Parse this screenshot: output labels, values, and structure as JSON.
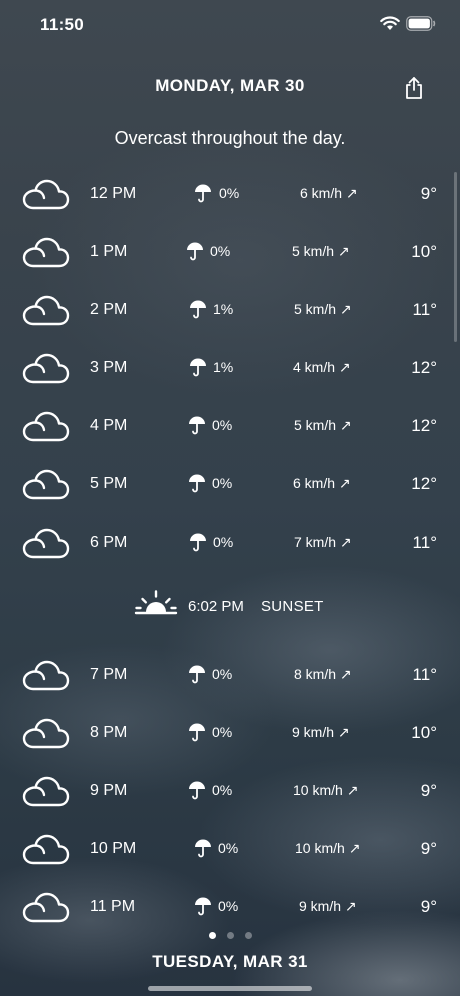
{
  "status": {
    "time": "11:50"
  },
  "header": {
    "title": "MONDAY, MAR 30"
  },
  "summary": "Overcast throughout the day.",
  "hours": [
    {
      "hour": "12 PM",
      "precip": "0%",
      "wind": "6 km/h ↗",
      "temp": "9°",
      "icon": "cloud-icon",
      "umbX": 194,
      "pctX": 219,
      "windX": 300
    },
    {
      "hour": "1 PM",
      "precip": "0%",
      "wind": "5 km/h ↗",
      "temp": "10°",
      "icon": "cloud-icon",
      "umbX": 186,
      "pctX": 210,
      "windX": 292
    },
    {
      "hour": "2 PM",
      "precip": "1%",
      "wind": "5 km/h ↗",
      "temp": "11°",
      "icon": "cloud-icon",
      "umbX": 189,
      "pctX": 213,
      "windX": 294
    },
    {
      "hour": "3 PM",
      "precip": "1%",
      "wind": "4 km/h ↗",
      "temp": "12°",
      "icon": "cloud-icon",
      "umbX": 189,
      "pctX": 213,
      "windX": 293
    },
    {
      "hour": "4 PM",
      "precip": "0%",
      "wind": "5 km/h ↗",
      "temp": "12°",
      "icon": "cloud-icon",
      "umbX": 188,
      "pctX": 212,
      "windX": 294
    },
    {
      "hour": "5 PM",
      "precip": "0%",
      "wind": "6 km/h ↗",
      "temp": "12°",
      "icon": "cloud-icon",
      "umbX": 188,
      "pctX": 212,
      "windX": 293
    },
    {
      "hour": "6 PM",
      "precip": "0%",
      "wind": "7 km/h ↗",
      "temp": "11°",
      "icon": "cloud-icon",
      "umbX": 189,
      "pctX": 213,
      "windX": 294
    },
    {
      "hour": "7 PM",
      "precip": "0%",
      "wind": "8 km/h ↗",
      "temp": "11°",
      "icon": "cloud-icon",
      "umbX": 188,
      "pctX": 212,
      "windX": 294
    },
    {
      "hour": "8 PM",
      "precip": "0%",
      "wind": "9 km/h ↗",
      "temp": "10°",
      "icon": "cloud-icon",
      "umbX": 188,
      "pctX": 212,
      "windX": 292
    },
    {
      "hour": "9 PM",
      "precip": "0%",
      "wind": "10 km/h ↗",
      "temp": "9°",
      "icon": "cloud-icon",
      "umbX": 188,
      "pctX": 212,
      "windX": 293
    },
    {
      "hour": "10 PM",
      "precip": "0%",
      "wind": "10 km/h ↗",
      "temp": "9°",
      "icon": "cloud-icon",
      "umbX": 194,
      "pctX": 218,
      "windX": 295
    },
    {
      "hour": "11 PM",
      "precip": "0%",
      "wind": "9 km/h ↗",
      "temp": "9°",
      "icon": "cloud-icon",
      "umbX": 194,
      "pctX": 218,
      "windX": 299
    }
  ],
  "sunset": {
    "time": "6:02 PM",
    "label": "SUNSET",
    "icon": "sunset-icon",
    "after_index": 6
  },
  "pager": {
    "count": 3,
    "active": 0
  },
  "footer": {
    "title": "TUESDAY, MAR 31"
  }
}
